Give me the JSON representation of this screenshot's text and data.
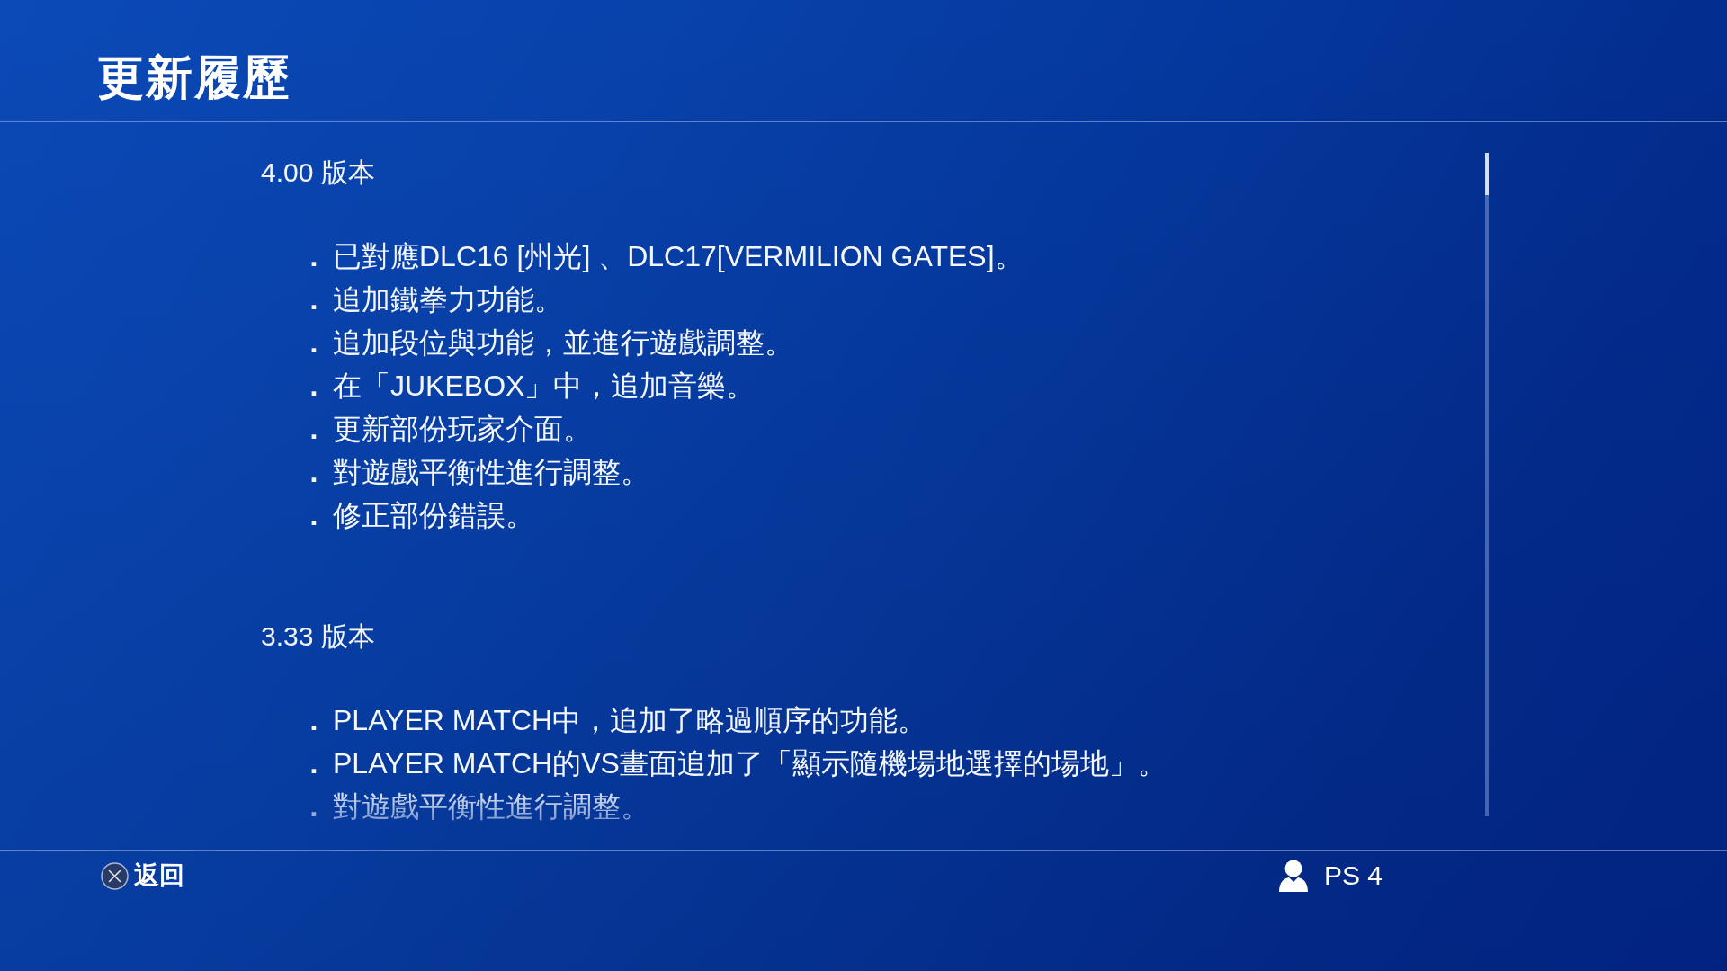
{
  "header": {
    "title": "更新履歷"
  },
  "history": [
    {
      "version": "4.00 版本",
      "changes": [
        {
          "marker": ".",
          "text": "已對應DLC16 [州光] 、DLC17[VERMILION GATES]。"
        },
        {
          "marker": ".",
          "text": "追加鐵拳力功能。"
        },
        {
          "marker": ".",
          "text": "追加段位與功能，並進行遊戲調整。"
        },
        {
          "marker": ".",
          "text": "在「JUKEBOX」中，追加音樂。"
        },
        {
          "marker": ".",
          "text": "更新部份玩家介面。"
        },
        {
          "marker": ".",
          "text": "對遊戲平衡性進行調整。"
        },
        {
          "marker": ".",
          "text": "修正部份錯誤。"
        }
      ]
    },
    {
      "version": "3.33 版本",
      "changes": [
        {
          "marker": ".",
          "text": "PLAYER MATCH中，追加了略過順序的功能。"
        },
        {
          "marker": ".",
          "text": "PLAYER MATCH的VS畫面追加了「顯示隨機場地選擇的場地」。"
        },
        {
          "marker": ".",
          "text": "對遊戲平衡性進行調整。"
        }
      ]
    }
  ],
  "footer": {
    "back_hint": "返回",
    "user_name": "PS 4"
  }
}
